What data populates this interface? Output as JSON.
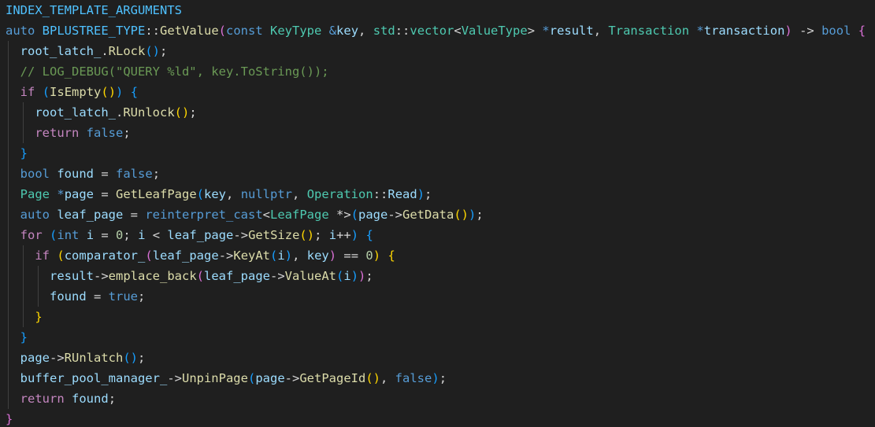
{
  "colors": {
    "background": "#1f1f1f",
    "macro": "#4fc1ff",
    "keyword": "#569cd6",
    "control": "#c586c0",
    "type": "#4ec9b0",
    "function": "#dcdcaa",
    "variable": "#9cdcfe",
    "plain": "#d4d4d4",
    "number": "#b5cea8",
    "comment": "#6a9955",
    "bracket1": "#ffd700",
    "bracket2": "#da70d6",
    "bracket3": "#179fff"
  },
  "code": {
    "lines": [
      {
        "indent": 0,
        "tokens": [
          {
            "t": "INDEX_TEMPLATE_ARGUMENTS",
            "c": "macro"
          }
        ]
      },
      {
        "indent": 0,
        "tokens": [
          {
            "t": "auto",
            "c": "keyword"
          },
          {
            "t": " ",
            "c": "plain"
          },
          {
            "t": "BPLUSTREE_TYPE",
            "c": "macro"
          },
          {
            "t": "::",
            "c": "plain"
          },
          {
            "t": "GetValue",
            "c": "function"
          },
          {
            "t": "(",
            "c": "bracket2"
          },
          {
            "t": "const",
            "c": "keyword"
          },
          {
            "t": " ",
            "c": "plain"
          },
          {
            "t": "KeyType",
            "c": "type"
          },
          {
            "t": " ",
            "c": "plain"
          },
          {
            "t": "&",
            "c": "keyword"
          },
          {
            "t": "key",
            "c": "variable"
          },
          {
            "t": ", ",
            "c": "plain"
          },
          {
            "t": "std",
            "c": "type"
          },
          {
            "t": "::",
            "c": "plain"
          },
          {
            "t": "vector",
            "c": "type"
          },
          {
            "t": "<",
            "c": "plain"
          },
          {
            "t": "ValueType",
            "c": "type"
          },
          {
            "t": "> ",
            "c": "plain"
          },
          {
            "t": "*",
            "c": "keyword"
          },
          {
            "t": "result",
            "c": "variable"
          },
          {
            "t": ", ",
            "c": "plain"
          },
          {
            "t": "Transaction",
            "c": "type"
          },
          {
            "t": " ",
            "c": "plain"
          },
          {
            "t": "*",
            "c": "keyword"
          },
          {
            "t": "transaction",
            "c": "variable"
          },
          {
            "t": ")",
            "c": "bracket2"
          },
          {
            "t": " -> ",
            "c": "plain"
          },
          {
            "t": "bool",
            "c": "keyword"
          },
          {
            "t": " ",
            "c": "plain"
          },
          {
            "t": "{",
            "c": "bracket2"
          }
        ]
      },
      {
        "indent": 1,
        "tokens": [
          {
            "t": "root_latch_",
            "c": "variable"
          },
          {
            "t": ".",
            "c": "plain"
          },
          {
            "t": "RLock",
            "c": "function"
          },
          {
            "t": "()",
            "c": "bracket3"
          },
          {
            "t": ";",
            "c": "plain"
          }
        ]
      },
      {
        "indent": 1,
        "tokens": [
          {
            "t": "// LOG_DEBUG(\"QUERY %ld\", key.ToString());",
            "c": "comment"
          }
        ]
      },
      {
        "indent": 1,
        "tokens": [
          {
            "t": "if",
            "c": "control"
          },
          {
            "t": " ",
            "c": "plain"
          },
          {
            "t": "(",
            "c": "bracket3"
          },
          {
            "t": "IsEmpty",
            "c": "function"
          },
          {
            "t": "()",
            "c": "bracket1"
          },
          {
            "t": ")",
            "c": "bracket3"
          },
          {
            "t": " ",
            "c": "plain"
          },
          {
            "t": "{",
            "c": "bracket3"
          }
        ]
      },
      {
        "indent": 2,
        "tokens": [
          {
            "t": "root_latch_",
            "c": "variable"
          },
          {
            "t": ".",
            "c": "plain"
          },
          {
            "t": "RUnlock",
            "c": "function"
          },
          {
            "t": "()",
            "c": "bracket1"
          },
          {
            "t": ";",
            "c": "plain"
          }
        ]
      },
      {
        "indent": 2,
        "tokens": [
          {
            "t": "return",
            "c": "control"
          },
          {
            "t": " ",
            "c": "plain"
          },
          {
            "t": "false",
            "c": "keyword"
          },
          {
            "t": ";",
            "c": "plain"
          }
        ]
      },
      {
        "indent": 1,
        "tokens": [
          {
            "t": "}",
            "c": "bracket3"
          }
        ]
      },
      {
        "indent": 1,
        "tokens": [
          {
            "t": "bool",
            "c": "keyword"
          },
          {
            "t": " ",
            "c": "plain"
          },
          {
            "t": "found",
            "c": "variable"
          },
          {
            "t": " = ",
            "c": "plain"
          },
          {
            "t": "false",
            "c": "keyword"
          },
          {
            "t": ";",
            "c": "plain"
          }
        ]
      },
      {
        "indent": 1,
        "tokens": [
          {
            "t": "Page",
            "c": "type"
          },
          {
            "t": " ",
            "c": "plain"
          },
          {
            "t": "*",
            "c": "keyword"
          },
          {
            "t": "page",
            "c": "variable"
          },
          {
            "t": " = ",
            "c": "plain"
          },
          {
            "t": "GetLeafPage",
            "c": "function"
          },
          {
            "t": "(",
            "c": "bracket3"
          },
          {
            "t": "key",
            "c": "variable"
          },
          {
            "t": ", ",
            "c": "plain"
          },
          {
            "t": "nullptr",
            "c": "keyword"
          },
          {
            "t": ", ",
            "c": "plain"
          },
          {
            "t": "Operation",
            "c": "type"
          },
          {
            "t": "::",
            "c": "plain"
          },
          {
            "t": "Read",
            "c": "variable"
          },
          {
            "t": ")",
            "c": "bracket3"
          },
          {
            "t": ";",
            "c": "plain"
          }
        ]
      },
      {
        "indent": 1,
        "tokens": [
          {
            "t": "auto",
            "c": "keyword"
          },
          {
            "t": " ",
            "c": "plain"
          },
          {
            "t": "leaf_page",
            "c": "variable"
          },
          {
            "t": " = ",
            "c": "plain"
          },
          {
            "t": "reinterpret_cast",
            "c": "keyword"
          },
          {
            "t": "<",
            "c": "plain"
          },
          {
            "t": "LeafPage",
            "c": "type"
          },
          {
            "t": " *>",
            "c": "plain"
          },
          {
            "t": "(",
            "c": "bracket3"
          },
          {
            "t": "page",
            "c": "variable"
          },
          {
            "t": "->",
            "c": "plain"
          },
          {
            "t": "GetData",
            "c": "function"
          },
          {
            "t": "()",
            "c": "bracket1"
          },
          {
            "t": ")",
            "c": "bracket3"
          },
          {
            "t": ";",
            "c": "plain"
          }
        ]
      },
      {
        "indent": 1,
        "tokens": [
          {
            "t": "for",
            "c": "control"
          },
          {
            "t": " ",
            "c": "plain"
          },
          {
            "t": "(",
            "c": "bracket3"
          },
          {
            "t": "int",
            "c": "keyword"
          },
          {
            "t": " ",
            "c": "plain"
          },
          {
            "t": "i",
            "c": "variable"
          },
          {
            "t": " = ",
            "c": "plain"
          },
          {
            "t": "0",
            "c": "number"
          },
          {
            "t": "; ",
            "c": "plain"
          },
          {
            "t": "i",
            "c": "variable"
          },
          {
            "t": " < ",
            "c": "plain"
          },
          {
            "t": "leaf_page",
            "c": "variable"
          },
          {
            "t": "->",
            "c": "plain"
          },
          {
            "t": "GetSize",
            "c": "function"
          },
          {
            "t": "()",
            "c": "bracket1"
          },
          {
            "t": "; ",
            "c": "plain"
          },
          {
            "t": "i",
            "c": "variable"
          },
          {
            "t": "++",
            "c": "plain"
          },
          {
            "t": ")",
            "c": "bracket3"
          },
          {
            "t": " ",
            "c": "plain"
          },
          {
            "t": "{",
            "c": "bracket3"
          }
        ]
      },
      {
        "indent": 2,
        "tokens": [
          {
            "t": "if",
            "c": "control"
          },
          {
            "t": " ",
            "c": "plain"
          },
          {
            "t": "(",
            "c": "bracket1"
          },
          {
            "t": "comparator_",
            "c": "variable"
          },
          {
            "t": "(",
            "c": "bracket2"
          },
          {
            "t": "leaf_page",
            "c": "variable"
          },
          {
            "t": "->",
            "c": "plain"
          },
          {
            "t": "KeyAt",
            "c": "function"
          },
          {
            "t": "(",
            "c": "bracket3"
          },
          {
            "t": "i",
            "c": "variable"
          },
          {
            "t": ")",
            "c": "bracket3"
          },
          {
            "t": ", ",
            "c": "plain"
          },
          {
            "t": "key",
            "c": "variable"
          },
          {
            "t": ")",
            "c": "bracket2"
          },
          {
            "t": " == ",
            "c": "plain"
          },
          {
            "t": "0",
            "c": "number"
          },
          {
            "t": ")",
            "c": "bracket1"
          },
          {
            "t": " ",
            "c": "plain"
          },
          {
            "t": "{",
            "c": "bracket1"
          }
        ]
      },
      {
        "indent": 3,
        "tokens": [
          {
            "t": "result",
            "c": "variable"
          },
          {
            "t": "->",
            "c": "plain"
          },
          {
            "t": "emplace_back",
            "c": "function"
          },
          {
            "t": "(",
            "c": "bracket2"
          },
          {
            "t": "leaf_page",
            "c": "variable"
          },
          {
            "t": "->",
            "c": "plain"
          },
          {
            "t": "ValueAt",
            "c": "function"
          },
          {
            "t": "(",
            "c": "bracket3"
          },
          {
            "t": "i",
            "c": "variable"
          },
          {
            "t": ")",
            "c": "bracket3"
          },
          {
            "t": ")",
            "c": "bracket2"
          },
          {
            "t": ";",
            "c": "plain"
          }
        ]
      },
      {
        "indent": 3,
        "tokens": [
          {
            "t": "found",
            "c": "variable"
          },
          {
            "t": " = ",
            "c": "plain"
          },
          {
            "t": "true",
            "c": "keyword"
          },
          {
            "t": ";",
            "c": "plain"
          }
        ]
      },
      {
        "indent": 2,
        "tokens": [
          {
            "t": "}",
            "c": "bracket1"
          }
        ]
      },
      {
        "indent": 1,
        "tokens": [
          {
            "t": "}",
            "c": "bracket3"
          }
        ]
      },
      {
        "indent": 1,
        "tokens": [
          {
            "t": "page",
            "c": "variable"
          },
          {
            "t": "->",
            "c": "plain"
          },
          {
            "t": "RUnlatch",
            "c": "function"
          },
          {
            "t": "()",
            "c": "bracket3"
          },
          {
            "t": ";",
            "c": "plain"
          }
        ]
      },
      {
        "indent": 1,
        "tokens": [
          {
            "t": "buffer_pool_manager_",
            "c": "variable"
          },
          {
            "t": "->",
            "c": "plain"
          },
          {
            "t": "UnpinPage",
            "c": "function"
          },
          {
            "t": "(",
            "c": "bracket3"
          },
          {
            "t": "page",
            "c": "variable"
          },
          {
            "t": "->",
            "c": "plain"
          },
          {
            "t": "GetPageId",
            "c": "function"
          },
          {
            "t": "()",
            "c": "bracket1"
          },
          {
            "t": ", ",
            "c": "plain"
          },
          {
            "t": "false",
            "c": "keyword"
          },
          {
            "t": ")",
            "c": "bracket3"
          },
          {
            "t": ";",
            "c": "plain"
          }
        ]
      },
      {
        "indent": 1,
        "tokens": [
          {
            "t": "return",
            "c": "control"
          },
          {
            "t": " ",
            "c": "plain"
          },
          {
            "t": "found",
            "c": "variable"
          },
          {
            "t": ";",
            "c": "plain"
          }
        ]
      },
      {
        "indent": 0,
        "tokens": [
          {
            "t": "}",
            "c": "bracket2"
          }
        ]
      }
    ]
  }
}
